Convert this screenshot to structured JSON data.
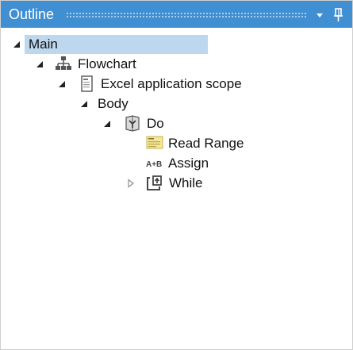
{
  "panel": {
    "title": "Outline",
    "colors": {
      "titlebar": "#3f8fd2",
      "selection": "#bcd7ee",
      "text": "#111111",
      "expander": "#222222"
    },
    "buttons": {
      "dropdown_icon": "chevron-down-icon",
      "pin_icon": "pin-icon"
    }
  },
  "tree": {
    "nodes": [
      {
        "label": "Main",
        "expander": "expanded",
        "icon": "none",
        "selected": true
      },
      {
        "label": "Flowchart",
        "expander": "expanded",
        "icon": "flowchart-icon"
      },
      {
        "label": "Excel application scope",
        "expander": "expanded",
        "icon": "document-icon"
      },
      {
        "label": "Body",
        "expander": "expanded",
        "icon": "none"
      },
      {
        "label": "Do",
        "expander": "expanded",
        "icon": "sequence-icon"
      },
      {
        "label": "Read Range",
        "expander": "none",
        "icon": "read-range-icon"
      },
      {
        "label": "Assign",
        "expander": "none",
        "icon": "assign-icon",
        "icon_text": "A+B"
      },
      {
        "label": "While",
        "expander": "collapsed",
        "icon": "while-loop-icon"
      }
    ]
  }
}
